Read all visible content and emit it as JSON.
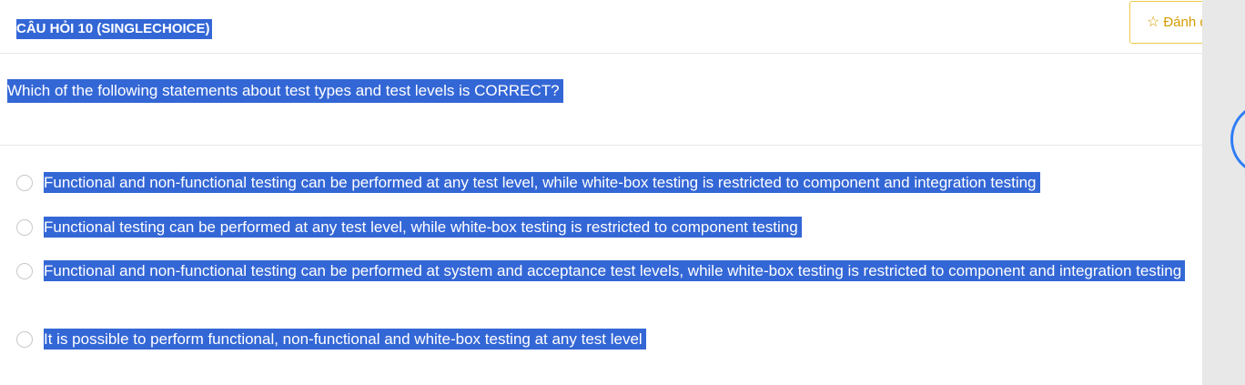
{
  "header": {
    "question_label": "CÂU HỎI 10 (SINGLECHOICE)",
    "mark_button": {
      "icon": "star-outline-icon",
      "label": "Đánh dấu"
    }
  },
  "question": {
    "text": "Which of the following statements about test types and test levels is CORRECT?"
  },
  "options": [
    {
      "text": "Functional and non-functional testing can be performed at any test level, while white-box testing is restricted to component and integration testing"
    },
    {
      "text": "Functional testing can be performed at any test level, while white-box testing is restricted to component testing"
    },
    {
      "text": "Functional and non-functional testing can be performed at system and acceptance test levels, while white-box testing is restricted to component and integration testing"
    },
    {
      "text": "It is possible to perform functional, non-functional and white-box testing at any test level"
    }
  ],
  "colors": {
    "selection_highlight": "#3467d6",
    "mark_button_accent": "#d59b00",
    "right_panel": "#e8e8e8"
  }
}
